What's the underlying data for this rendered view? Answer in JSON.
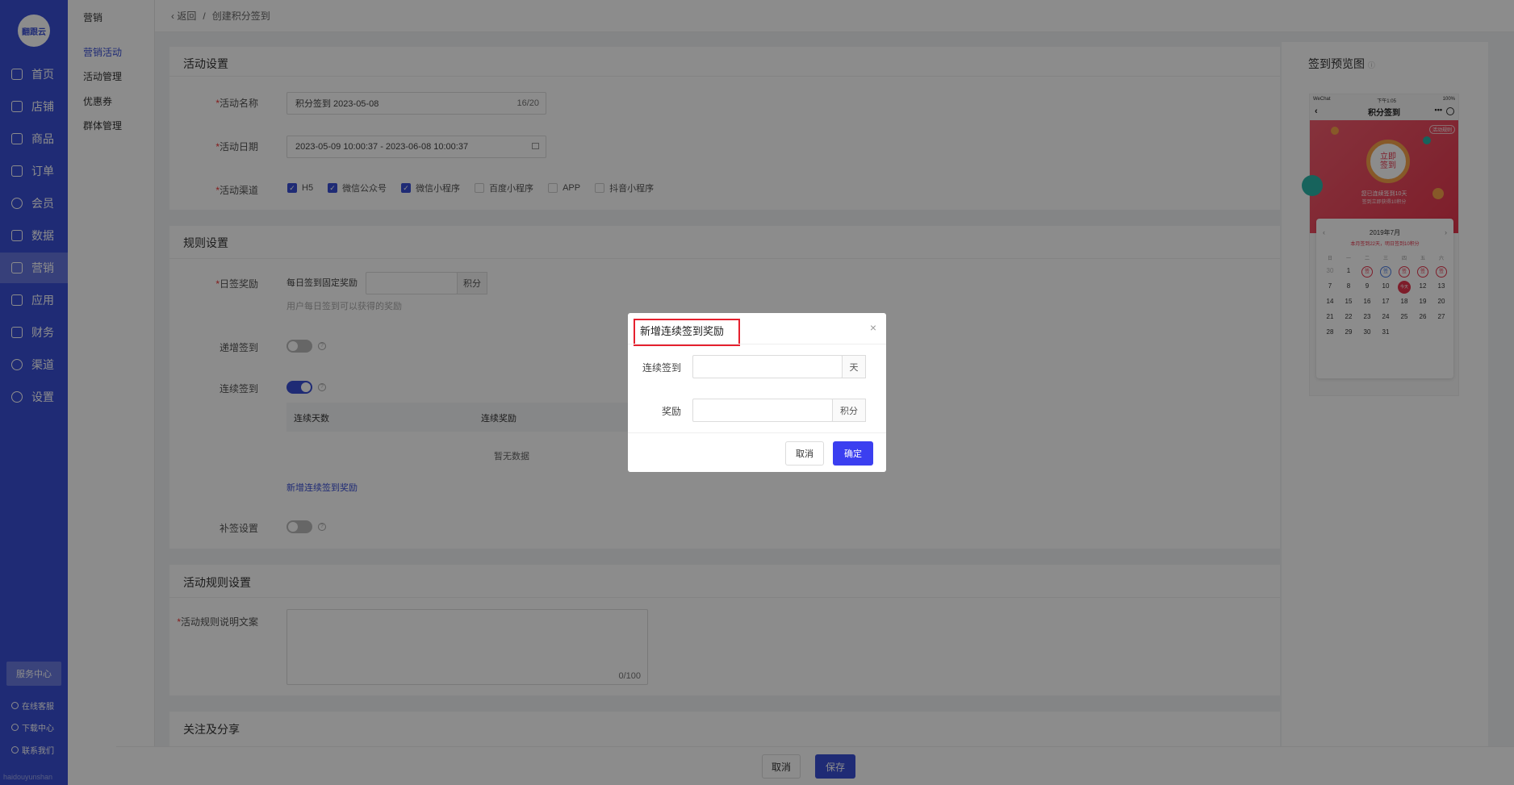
{
  "sidebar": {
    "logo": "翻跟云",
    "items": [
      {
        "label": "首页",
        "icon": "home-icon"
      },
      {
        "label": "店铺",
        "icon": "shop-icon"
      },
      {
        "label": "商品",
        "icon": "goods-icon"
      },
      {
        "label": "订单",
        "icon": "order-icon"
      },
      {
        "label": "会员",
        "icon": "member-icon"
      },
      {
        "label": "数据",
        "icon": "chart-icon"
      },
      {
        "label": "营销",
        "icon": "tag-icon"
      },
      {
        "label": "应用",
        "icon": "app-icon"
      },
      {
        "label": "财务",
        "icon": "finance-icon"
      },
      {
        "label": "渠道",
        "icon": "channel-icon"
      },
      {
        "label": "设置",
        "icon": "gear-icon"
      }
    ],
    "active_index": 6,
    "service_center": "服务中心",
    "links": [
      "在线客服",
      "下载中心",
      "联系我们"
    ],
    "brand_foot": "haidouyunshan"
  },
  "subnav": {
    "title": "营销",
    "items": [
      "营销活动",
      "活动管理",
      "优惠券",
      "群体管理"
    ],
    "active_index": 0
  },
  "breadcrumb": {
    "back": "返回",
    "separator": "/",
    "current": "创建积分签到"
  },
  "activity_settings": {
    "title": "活动设置",
    "name_label": "活动名称",
    "name_value": "积分签到 2023-05-08",
    "name_count": "16/20",
    "date_label": "活动日期",
    "date_value": "2023-05-09 10:00:37 - 2023-06-08 10:00:37",
    "channel_label": "活动渠道",
    "channels": [
      {
        "label": "H5",
        "checked": true
      },
      {
        "label": "微信公众号",
        "checked": true
      },
      {
        "label": "微信小程序",
        "checked": true
      },
      {
        "label": "百度小程序",
        "checked": false
      },
      {
        "label": "APP",
        "checked": false
      },
      {
        "label": "抖音小程序",
        "checked": false
      }
    ]
  },
  "rule_settings": {
    "title": "规则设置",
    "daily_label": "日签奖励",
    "daily_text": "每日签到固定奖励",
    "daily_unit": "积分",
    "daily_hint": "用户每日签到可以获得的奖励",
    "weekly_label": "递增签到",
    "weekly_on": false,
    "consecutive_label": "连续签到",
    "consecutive_on": true,
    "table_headers": [
      "连续天数",
      "连续奖励"
    ],
    "table_empty": "暂无数据",
    "add_link": "新增连续签到奖励",
    "makeup_label": "补签设置",
    "makeup_on": false
  },
  "rules_text": {
    "title": "活动规则设置",
    "label": "活动规则说明文案",
    "count": "0/100"
  },
  "share": {
    "title": "关注及分享"
  },
  "preview": {
    "title": "签到预览图",
    "status_left": "WeChat",
    "status_time": "下午1:05",
    "status_right": "100%",
    "page_title": "积分签到",
    "rules_tag": "活动规则",
    "sign_button": "立即签到",
    "streak_text": "您已连续签到10天",
    "streak_sub": "签到立即获得10积分",
    "cal_title": "2019年7月",
    "cal_sub": "本月签到22天，明日签到10积分",
    "weekdays": [
      "日",
      "一",
      "二",
      "三",
      "四",
      "五",
      "六"
    ],
    "days": [
      "30",
      "1",
      "2",
      "3",
      "4",
      "5",
      "6",
      "7",
      "8",
      "9",
      "10",
      "11",
      "12",
      "13",
      "14",
      "15",
      "16",
      "17",
      "18",
      "19",
      "20",
      "21",
      "22",
      "23",
      "24",
      "25",
      "26",
      "27",
      "28",
      "29",
      "30",
      "31"
    ],
    "marked_label": "签",
    "today_label": "今天"
  },
  "footer": {
    "cancel": "取消",
    "save": "保存"
  },
  "dialog": {
    "title": "新增连续签到奖励",
    "days_label": "连续签到",
    "days_unit": "天",
    "days_value": "",
    "reward_label": "奖励",
    "reward_unit": "积分",
    "reward_value": "",
    "cancel": "取消",
    "confirm": "确定"
  },
  "colors": {
    "primary": "#3a4fd6",
    "danger": "#e5202e"
  }
}
